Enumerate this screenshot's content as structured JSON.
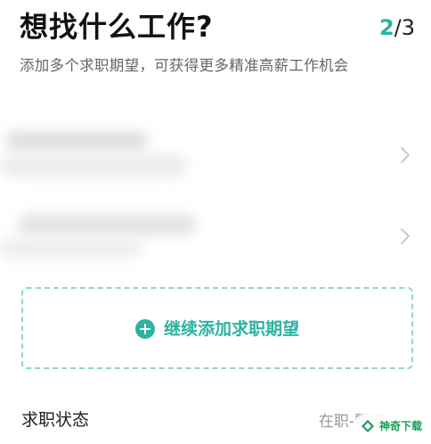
{
  "header": {
    "title": "想找什么工作?",
    "step_current": "2",
    "step_total": "/3",
    "subtitle": "添加多个求职期望，可获得更多精准高薪工作机会"
  },
  "expectation_rows": [
    {
      "icon": "chevron-right-icon"
    },
    {
      "icon": "chevron-right-icon"
    }
  ],
  "add_button": {
    "label": "继续添加求职期望",
    "icon": "plus-circle-icon"
  },
  "status": {
    "label": "求职状态",
    "value": "在职-暂不"
  },
  "watermark": {
    "text": "神奇下载"
  },
  "colors": {
    "accent": "#2bb3a3",
    "dashed_border": "#8fd6cc",
    "muted_text": "#999999",
    "watermark_green": "#1a9c5a"
  }
}
